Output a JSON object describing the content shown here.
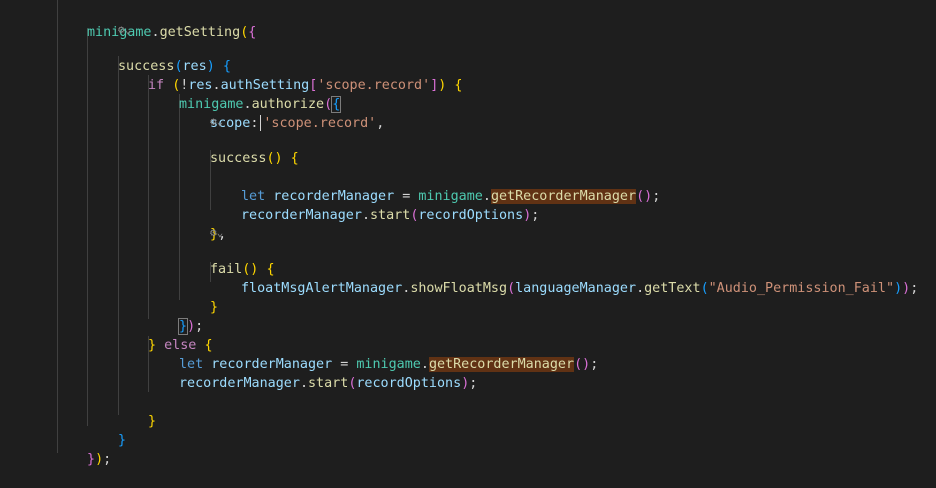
{
  "code": {
    "minigame": "minigame",
    "getSetting": "getSetting",
    "success": "success",
    "res": "res",
    "if_kw": "if",
    "auth_setting": "authSetting",
    "scope_record_str": "'scope.record'",
    "authorize": "authorize",
    "scope_key": "scope",
    "let_kw": "let",
    "recorder_manager": "recorderManager",
    "get_recorder_manager": "getRecorderManager",
    "start": "start",
    "record_options": "recordOptions",
    "fail": "fail",
    "float_msg_manager": "floatMsgAlertManager",
    "show_float_msg": "showFloatMsg",
    "language_manager": "languageManager",
    "get_text": "getText",
    "audio_perm_str": "\"Audio_Permission_Fail\"",
    "else_kw": "else"
  },
  "codelens": {
    "icon": "settings-gear-icon",
    "glyph": "⚙⌄"
  },
  "colors": {
    "background": "#1e1e1e",
    "object": "#4ec9b0",
    "function": "#dcdcaa",
    "property": "#9cdcfe",
    "control_keyword": "#c586c0",
    "declaration_keyword": "#569cd6",
    "string": "#ce9178",
    "bracket_level_1": "#ffd700",
    "bracket_level_2": "#da70d6",
    "bracket_level_3": "#179fff",
    "selection_highlight": "#613214"
  }
}
